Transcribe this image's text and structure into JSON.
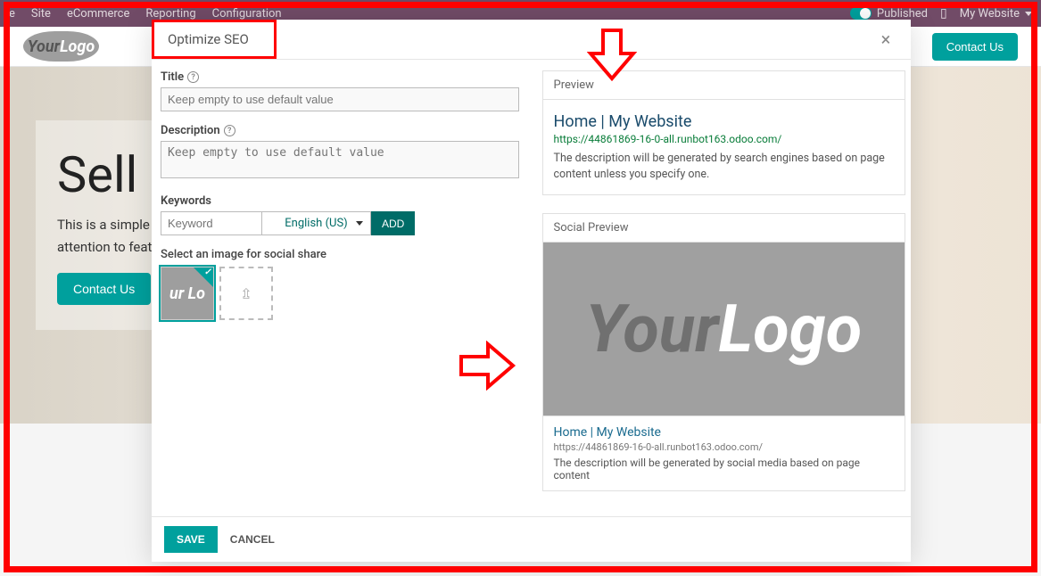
{
  "topbar": {
    "menu": [
      "e",
      "Site",
      "eCommerce",
      "Reporting",
      "Configuration"
    ],
    "published": "Published",
    "my_website": "My Website"
  },
  "subbar": {
    "logo_text1": "Your",
    "logo_text2": "Logo",
    "contact": "Contact Us"
  },
  "hero": {
    "title": "Sell O",
    "text1": "This is a simple hero u",
    "text2": "attention to featured c",
    "btn": "Contact Us"
  },
  "modal": {
    "title": "Optimize SEO",
    "labels": {
      "title": "Title",
      "description": "Description",
      "keywords": "Keywords",
      "select_image": "Select an image for social share"
    },
    "placeholders": {
      "title": "Keep empty to use default value",
      "description": "Keep empty to use default value",
      "keyword": "Keyword"
    },
    "lang": "English (US)",
    "add": "ADD",
    "thumb_text": "ur Lo",
    "preview": {
      "header": "Preview",
      "title": "Home | My Website",
      "url": "https://44861869-16-0-all.runbot163.odoo.com/",
      "desc": "The description will be generated by search engines based on page content unless you specify one."
    },
    "social": {
      "header": "Social Preview",
      "logo1": "Your",
      "logo2": "Logo",
      "title": "Home | My Website",
      "url": "https://44861869-16-0-all.runbot163.odoo.com/",
      "desc": "The description will be generated by social media based on page content"
    },
    "footer": {
      "save": "SAVE",
      "cancel": "CANCEL"
    }
  }
}
